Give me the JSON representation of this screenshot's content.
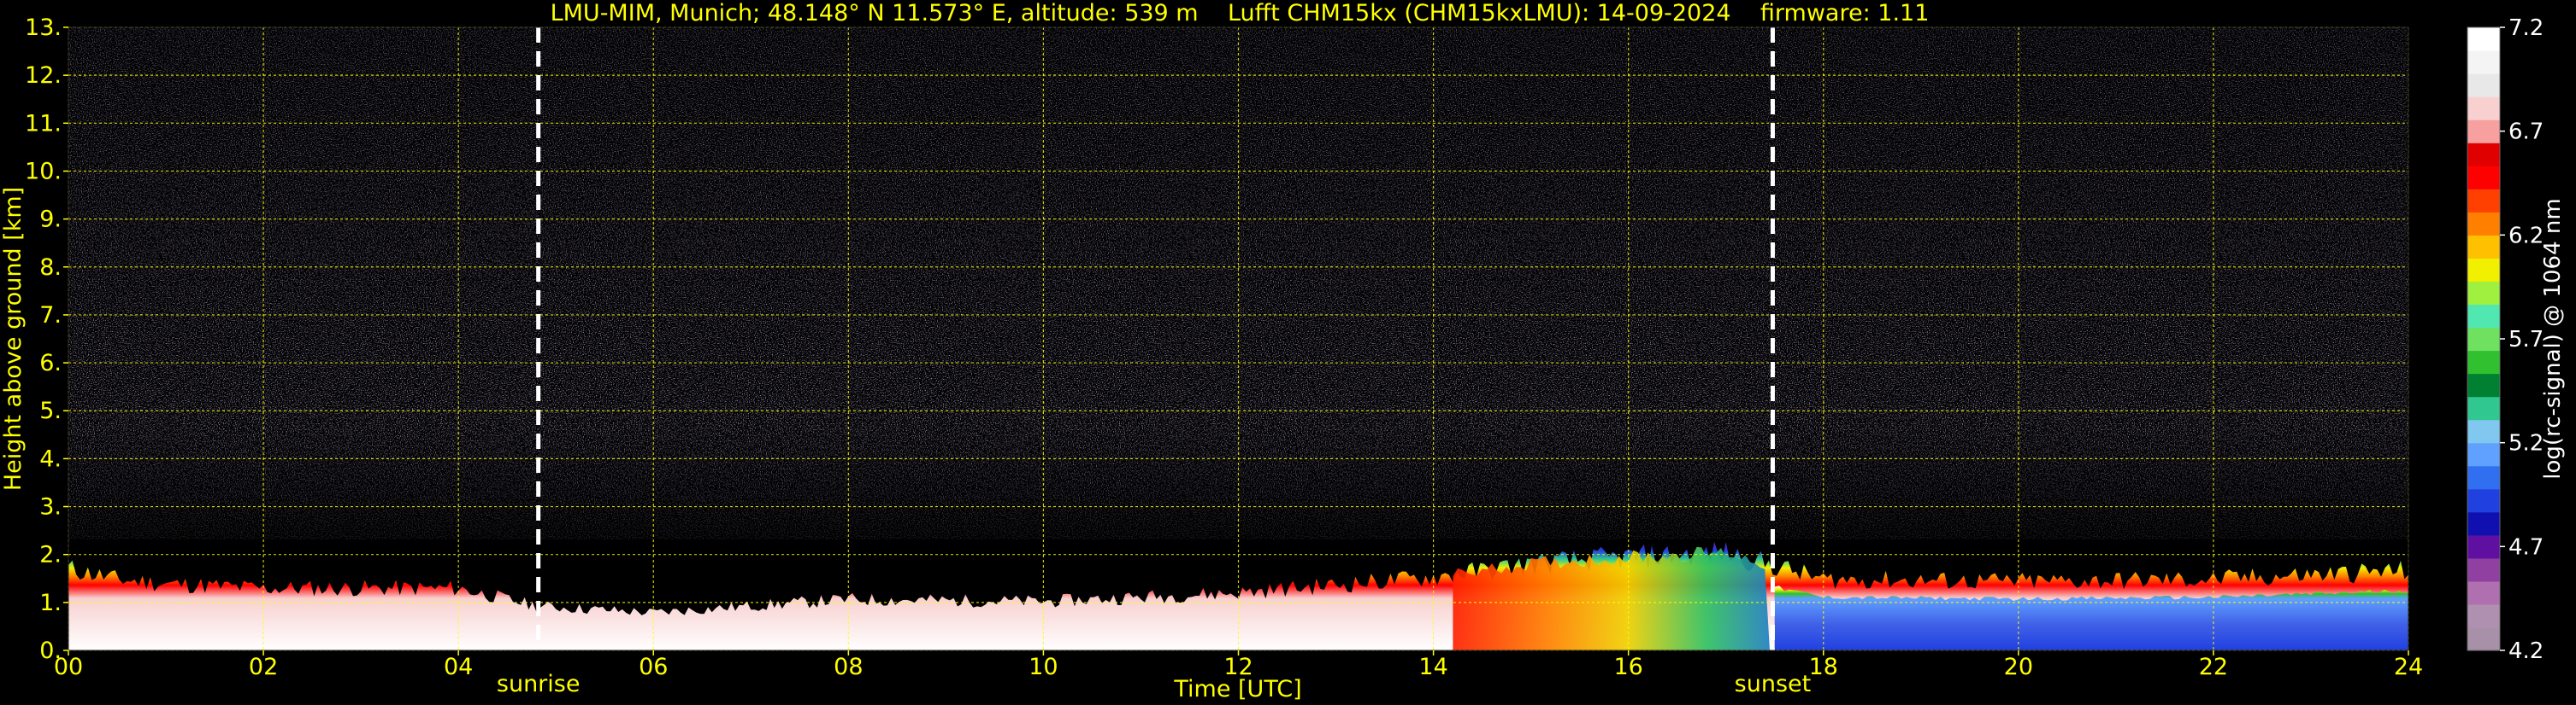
{
  "chart_data": {
    "type": "heatmap",
    "title": "LMU-MIM, Munich; 48.148° N 11.573° E, altitude: 539 m    Lufft CHM15kx (CHM15kxLMU): 14-09-2024    firmware: 1.11",
    "xlabel": "Time [UTC]",
    "ylabel": "Height above ground [km]",
    "x_unit": "hours UTC",
    "xlim": [
      0,
      24
    ],
    "ylim": [
      0,
      13
    ],
    "x_ticks": [
      "00",
      "02",
      "04",
      "06",
      "08",
      "10",
      "12",
      "14",
      "16",
      "18",
      "20",
      "22",
      "24"
    ],
    "y_ticks": [
      "0.",
      "1.",
      "2.",
      "3.",
      "4.",
      "5.",
      "6.",
      "7.",
      "8.",
      "9.",
      "10.",
      "11.",
      "12.",
      "13."
    ],
    "grid": true,
    "grid_color": "#ffff00",
    "annotations": [
      {
        "label": "sunrise",
        "x": 4.82
      },
      {
        "label": "sunset",
        "x": 17.48
      }
    ],
    "colorbar": {
      "label": "log(rc-signal) @ 1064 nm",
      "min": 4.2,
      "max": 7.2,
      "ticks": [
        "7.2",
        "6.7",
        "6.2",
        "5.7",
        "5.2",
        "4.7",
        "4.2"
      ],
      "colors": [
        "#a890a8",
        "#b090b0",
        "#b070b0",
        "#9040a0",
        "#6010a0",
        "#1010b0",
        "#2040e0",
        "#3070f0",
        "#60a0ff",
        "#80c8f0",
        "#30c890",
        "#008030",
        "#30c030",
        "#70e060",
        "#50e8b0",
        "#a0f040",
        "#f0f000",
        "#ffc000",
        "#ff8000",
        "#ff4000",
        "#ff0000",
        "#e00000",
        "#f8a0a0",
        "#f8d0d0",
        "#e8e8e8",
        "#f4f4f4",
        "#ffffff"
      ]
    },
    "boundary_layer_top_km": [
      {
        "x": 0,
        "y": 1.85
      },
      {
        "x": 0.5,
        "y": 1.6
      },
      {
        "x": 1,
        "y": 1.5
      },
      {
        "x": 2,
        "y": 1.4
      },
      {
        "x": 3,
        "y": 1.4
      },
      {
        "x": 4,
        "y": 1.4
      },
      {
        "x": 4.8,
        "y": 1.0
      },
      {
        "x": 6,
        "y": 0.85
      },
      {
        "x": 8,
        "y": 1.15
      },
      {
        "x": 10,
        "y": 1.1
      },
      {
        "x": 12,
        "y": 1.3
      },
      {
        "x": 14,
        "y": 1.65
      },
      {
        "x": 15,
        "y": 1.95
      },
      {
        "x": 16,
        "y": 2.1
      },
      {
        "x": 17,
        "y": 2.2
      },
      {
        "x": 18,
        "y": 1.6
      },
      {
        "x": 20,
        "y": 1.55
      },
      {
        "x": 22,
        "y": 1.6
      },
      {
        "x": 24,
        "y": 1.8
      }
    ]
  }
}
